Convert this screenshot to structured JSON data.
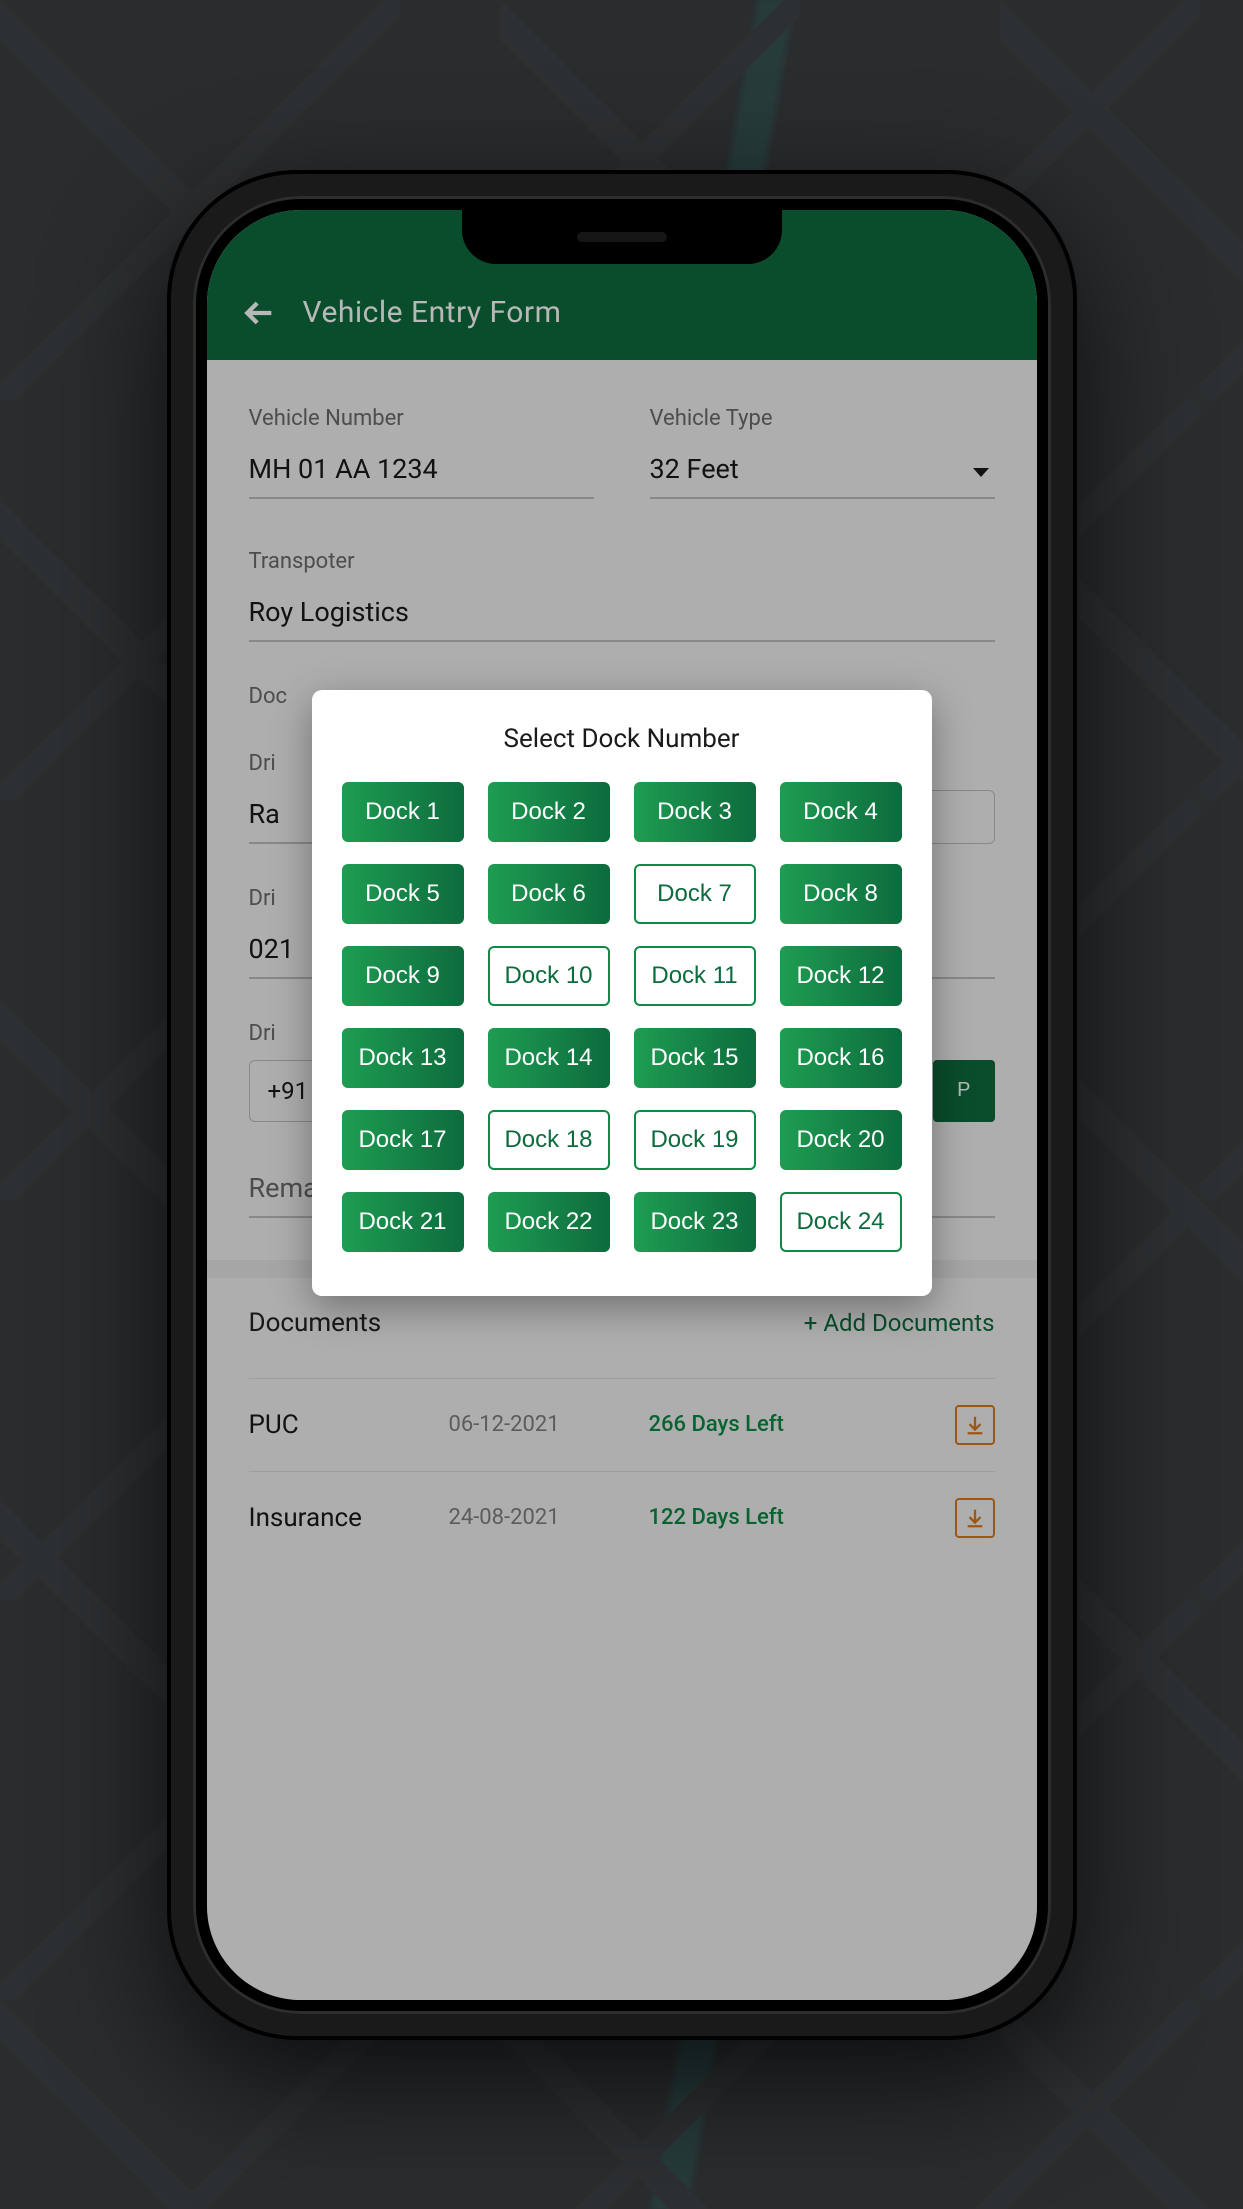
{
  "header": {
    "title": "Vehicle Entry Form"
  },
  "form": {
    "vehicle_number_label": "Vehicle Number",
    "vehicle_number_value": "MH 01 AA 1234",
    "vehicle_type_label": "Vehicle Type",
    "vehicle_type_value": "32 Feet",
    "transporter_label": "Transpoter",
    "transporter_value": "Roy Logistics",
    "dock_label_prefix": "Doc",
    "driver_label_prefix": "Dri",
    "driver_name_value": "Ra",
    "driver_dl_label_prefix": "Dri",
    "driver_dl_value": "021",
    "driver_mobile_label_prefix": "Dri",
    "driver_mobile_value": "+91",
    "otp_button": "P",
    "remark_label": "Remark"
  },
  "documents": {
    "section_title": "Documents",
    "add_label": "+ Add Documents",
    "rows": [
      {
        "name": "PUC",
        "date": "06-12-2021",
        "days_left": "266 Days Left"
      },
      {
        "name": "Insurance",
        "date": "24-08-2021",
        "days_left": "122 Days Left"
      }
    ]
  },
  "modal": {
    "title": "Select Dock Number",
    "docks": [
      {
        "label": "Dock 1",
        "outlined": false
      },
      {
        "label": "Dock 2",
        "outlined": false
      },
      {
        "label": "Dock 3",
        "outlined": false
      },
      {
        "label": "Dock 4",
        "outlined": false
      },
      {
        "label": "Dock 5",
        "outlined": false
      },
      {
        "label": "Dock 6",
        "outlined": false
      },
      {
        "label": "Dock 7",
        "outlined": true
      },
      {
        "label": "Dock 8",
        "outlined": false
      },
      {
        "label": "Dock 9",
        "outlined": false
      },
      {
        "label": "Dock 10",
        "outlined": true
      },
      {
        "label": "Dock 11",
        "outlined": true
      },
      {
        "label": "Dock 12",
        "outlined": false
      },
      {
        "label": "Dock 13",
        "outlined": false
      },
      {
        "label": "Dock 14",
        "outlined": false
      },
      {
        "label": "Dock 15",
        "outlined": false
      },
      {
        "label": "Dock 16",
        "outlined": false
      },
      {
        "label": "Dock 17",
        "outlined": false
      },
      {
        "label": "Dock 18",
        "outlined": true
      },
      {
        "label": "Dock 19",
        "outlined": true
      },
      {
        "label": "Dock 20",
        "outlined": false
      },
      {
        "label": "Dock 21",
        "outlined": false
      },
      {
        "label": "Dock 22",
        "outlined": false
      },
      {
        "label": "Dock 23",
        "outlined": false
      },
      {
        "label": "Dock 24",
        "outlined": true
      }
    ]
  }
}
